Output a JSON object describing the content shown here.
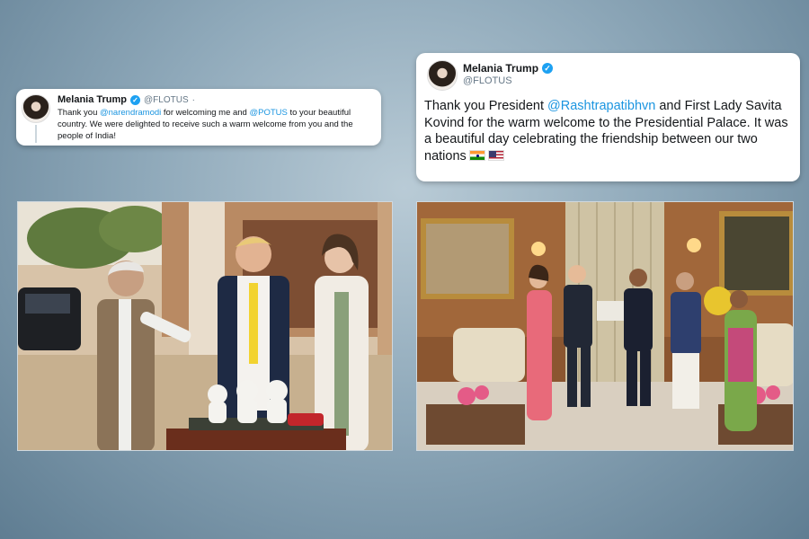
{
  "tweet_left": {
    "name": "Melania Trump",
    "handle": "@FLOTUS",
    "separator": "·",
    "text_parts": [
      "Thank you ",
      "@narendramodi",
      " for welcoming me and ",
      "@POTUS",
      " to your beautiful country. We were delighted to receive such a warm welcome from you and the people of India!"
    ]
  },
  "tweet_right": {
    "name": "Melania Trump",
    "handle": "@FLOTUS",
    "text_parts": [
      "Thank you President ",
      "@Rashtrapatibhvn",
      " and First Lady Savita Kovind for the warm welcome to the Presidential Palace. It was a beautiful day celebrating the friendship between our two nations"
    ],
    "flags": [
      "india-flag-icon",
      "us-flag-icon"
    ]
  },
  "colors": {
    "mention": "#1b95e0",
    "verified": "#1da1f2",
    "background": "#8fa9ba"
  }
}
